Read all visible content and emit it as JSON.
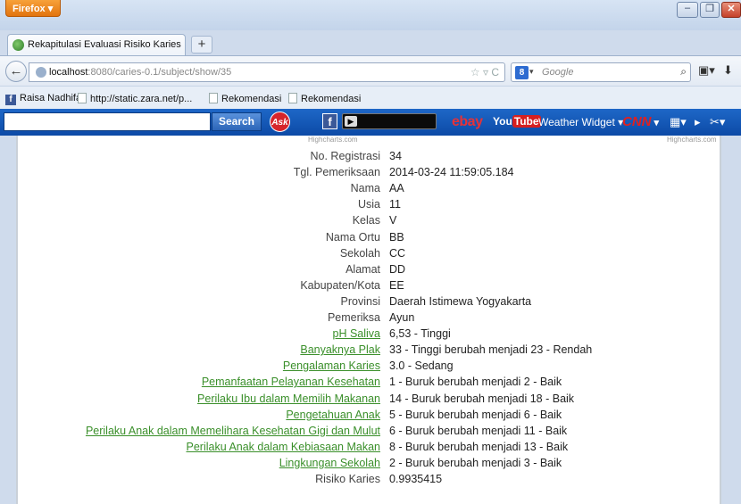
{
  "browser": {
    "menu_label": "Firefox",
    "tab_title": "Rekapitulasi Evaluasi Risiko Karies",
    "url_host": "localhost",
    "url_path": ":8080/caries-0.1/subject/show/35",
    "search_placeholder": "Google",
    "search_engine_label": "8"
  },
  "bookmarks": [
    {
      "label": "Raisa Nadhifa",
      "icon": "facebook-icon"
    },
    {
      "label": "http://static.zara.net/p...",
      "icon": "page-icon"
    },
    {
      "label": "Rekomendasi",
      "icon": "page-icon"
    },
    {
      "label": "Rekomendasi",
      "icon": "page-icon"
    }
  ],
  "toolbar": {
    "search_button": "Search",
    "ask_label": "Ask",
    "ebay_label": "ebay",
    "youtube_you": "You",
    "youtube_tube": "Tube",
    "weather_label": "Weather Widget",
    "cnn_label": "CNN",
    "colors": {
      "toolbar_bg": "#1b5fbf"
    }
  },
  "page": {
    "watermark_left": "Highcharts.com",
    "watermark_right": "Highcharts.com",
    "records": [
      {
        "label": "No. Registrasi",
        "value": "34",
        "link": false
      },
      {
        "label": "Tgl. Pemeriksaan",
        "value": "2014-03-24 11:59:05.184",
        "link": false
      },
      {
        "label": "Nama",
        "value": "AA",
        "link": false
      },
      {
        "label": "Usia",
        "value": "11",
        "link": false
      },
      {
        "label": "Kelas",
        "value": "V",
        "link": false
      },
      {
        "label": "Nama Ortu",
        "value": "BB",
        "link": false
      },
      {
        "label": "Sekolah",
        "value": "CC",
        "link": false
      },
      {
        "label": "Alamat",
        "value": "DD",
        "link": false
      },
      {
        "label": "Kabupaten/Kota",
        "value": "EE",
        "link": false
      },
      {
        "label": "Provinsi",
        "value": "Daerah Istimewa Yogyakarta",
        "link": false
      },
      {
        "label": "Pemeriksa",
        "value": "Ayun",
        "link": false
      },
      {
        "label": "pH Saliva",
        "value": "6,53 - Tinggi",
        "link": true
      },
      {
        "label": "Banyaknya Plak",
        "value": "33 - Tinggi berubah menjadi 23 - Rendah",
        "link": true
      },
      {
        "label": "Pengalaman Karies",
        "value": "3.0 - Sedang",
        "link": true
      },
      {
        "label": "Pemanfaatan Pelayanan Kesehatan",
        "value": "1 - Buruk berubah menjadi 2 - Baik",
        "link": true
      },
      {
        "label": "Perilaku Ibu dalam Memilih Makanan",
        "value": "14 - Buruk berubah menjadi 18 - Baik",
        "link": true
      },
      {
        "label": "Pengetahuan Anak",
        "value": "5 - Buruk berubah menjadi 6 - Baik",
        "link": true
      },
      {
        "label": "Perilaku Anak dalam Memelihara Kesehatan Gigi dan Mulut",
        "value": "6 - Buruk berubah menjadi 11 - Baik",
        "link": true
      },
      {
        "label": "Perilaku Anak dalam Kebiasaan Makan",
        "value": "8 - Buruk berubah menjadi 13 - Baik",
        "link": true
      },
      {
        "label": "Lingkungan Sekolah",
        "value": "2 - Buruk berubah menjadi 3 - Baik",
        "link": true
      },
      {
        "label": "Risiko Karies",
        "value": "0.9935415",
        "link": false
      }
    ]
  }
}
